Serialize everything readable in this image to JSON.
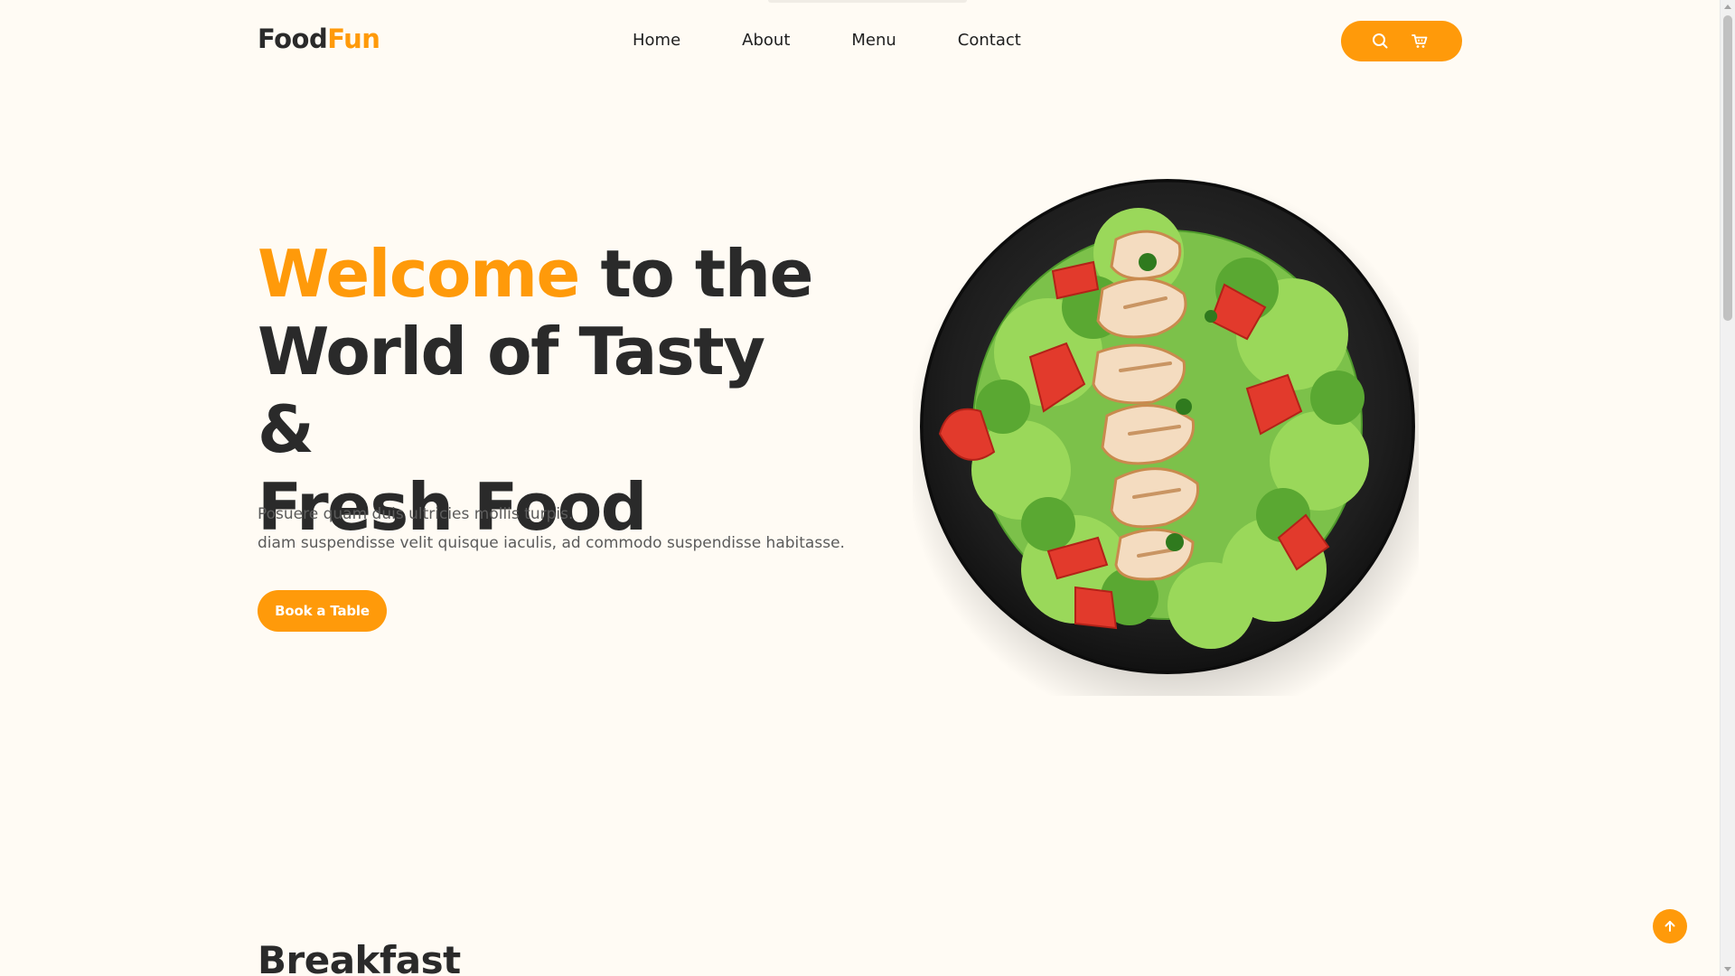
{
  "header": {
    "logo": {
      "part1": "Food",
      "part2": "Fun"
    },
    "nav": [
      "Home",
      "About",
      "Menu",
      "Contact"
    ],
    "actions": {
      "search_icon": "search-icon",
      "cart_icon": "cart-icon"
    }
  },
  "hero": {
    "title": {
      "accent": "Welcome",
      "rest_line1": " to the",
      "line2": "World of Tasty &",
      "line3": "Fresh Food"
    },
    "description": {
      "line1": "Posuere quam duis ultricies mollis turpis.",
      "line2": "diam suspendisse velit quisque iaculis, ad commodo suspendisse habitasse."
    },
    "cta_label": "Book a Table",
    "image": "salad-plate-image"
  },
  "next_section": {
    "title": "Breakfast"
  },
  "back_to_top_icon": "arrow-up-icon",
  "colors": {
    "accent": "#ff9a0a",
    "background": "#fffbf4",
    "text": "#2a2a2a",
    "muted": "#5b5b5b"
  }
}
